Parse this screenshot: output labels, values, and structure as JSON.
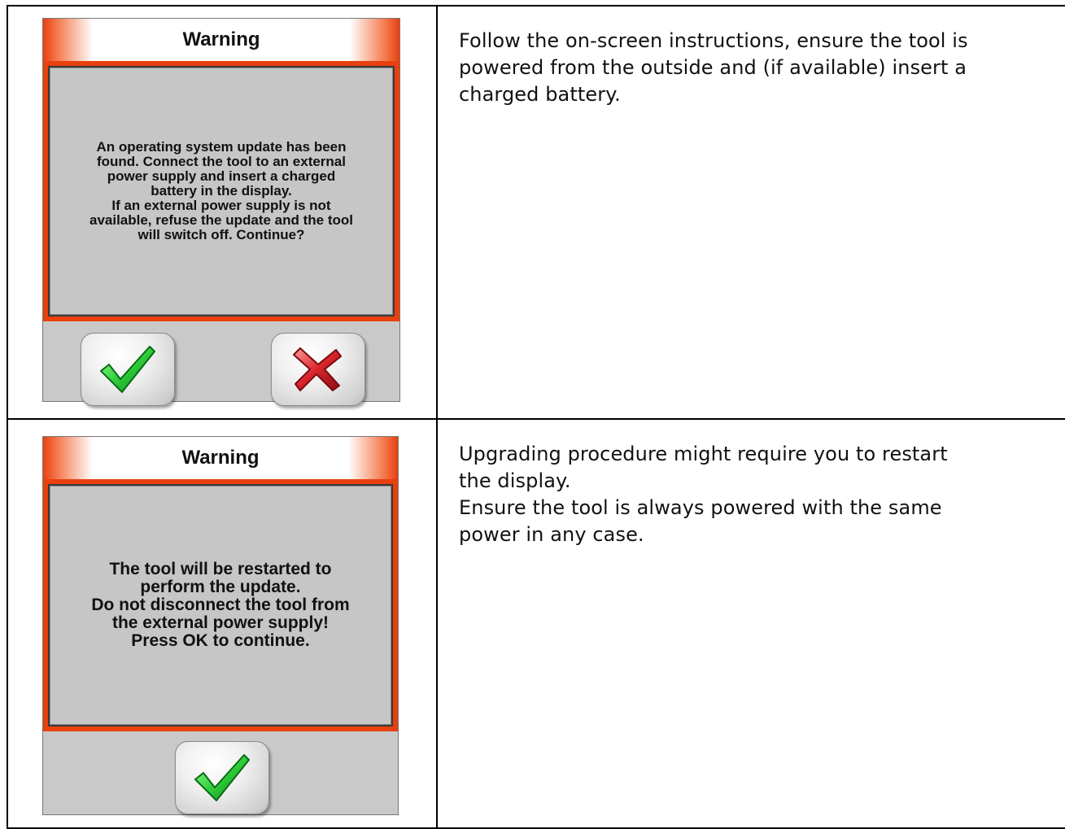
{
  "rows": [
    {
      "dialog": {
        "title": "Warning",
        "message": "An operating system update has been\nfound. Connect the tool to an external\npower supply and insert a charged\nbattery in the display.\nIf an external power supply is not\navailable, refuse the update and the tool\nwill switch off. Continue?",
        "buttons": [
          "confirm-check-icon",
          "cancel-x-icon"
        ]
      },
      "description": "Follow the on-screen instructions, ensure the tool is\npowered from the outside and (if available) insert a\ncharged battery."
    },
    {
      "dialog": {
        "title": "Warning",
        "message": "The tool will be restarted to\nperform the update.\nDo not disconnect the tool from\nthe external power supply!\nPress OK to continue.",
        "buttons": [
          "confirm-check-icon"
        ]
      },
      "description": "Upgrading procedure might require you to restart\nthe display.\nEnsure the tool is always powered with the same\npower in any case."
    }
  ],
  "colors": {
    "title_accent": "#e8400f",
    "dialog_body": "#c6c6c6",
    "check_green": "#2fcf3a",
    "cross_red": "#d8242a"
  }
}
